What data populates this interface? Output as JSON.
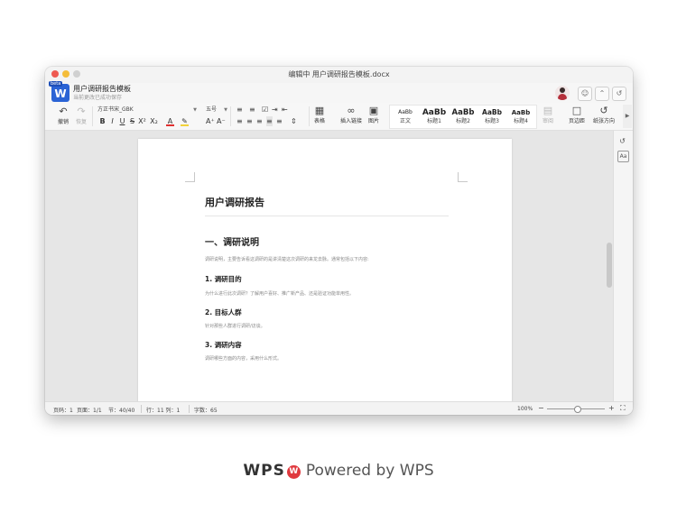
{
  "window": {
    "title": "编辑中 用户调研报告模板.docx",
    "doc_name": "用户调研报告模板",
    "save_status": "当前更改已成功保存",
    "logo_letter": "W",
    "beta_label": "beta"
  },
  "toolbar": {
    "undo": "撤销",
    "redo": "恢复",
    "font_name": "方正书宋_GBK",
    "font_size": "五号",
    "table": "表格",
    "insert_link": "插入链接",
    "image": "图片",
    "review": "审阅",
    "page_margin": "页边距",
    "paper_orientation": "纸张方向",
    "styles": [
      {
        "preview": "AaBb",
        "label": "正文"
      },
      {
        "preview": "AaBb",
        "label": "标题1"
      },
      {
        "preview": "AaBb",
        "label": "标题2"
      },
      {
        "preview": "AaBb",
        "label": "标题3"
      },
      {
        "preview": "AaBb",
        "label": "标题4"
      }
    ]
  },
  "document": {
    "title": "用户调研报告",
    "section1_heading": "一、调研说明",
    "section1_body": "调研说明，主要告诉看这调研的是讲清楚这次调研的来龙去脉。通常包括以下内容:",
    "sub1_heading": "1. 调研目的",
    "sub1_body": "为什么进行此次调研？了解用户喜好、推广新产品、还是验证功能单用性。",
    "sub2_heading": "2. 目标人群",
    "sub2_body": "针对那些人群进行调研/访谈。",
    "sub3_heading": "3. 调研内容",
    "sub3_body": "调研哪些方面的内容，采用什么形式。"
  },
  "statusbar": {
    "page": "页码：1",
    "pages": "页面：1/1",
    "section": "节：40/40",
    "row_col": "行：11  列：1",
    "word_count": "字数：65",
    "zoom": "100%"
  },
  "footer": {
    "brand": "WPS",
    "powered_by": "Powered by WPS"
  },
  "colors": {
    "accent": "#2a63d5",
    "brand_red": "#e0393e"
  }
}
